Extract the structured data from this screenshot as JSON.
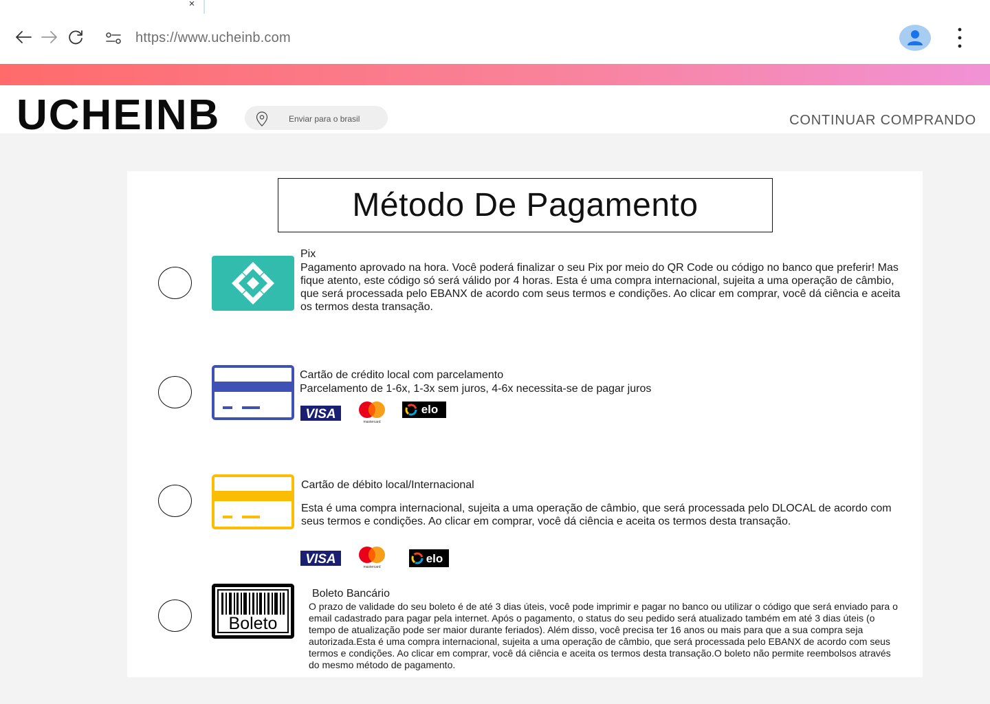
{
  "browser": {
    "tab_close_glyph": "×",
    "url": "https://www.ucheinb.com",
    "icons": [
      "close-icon",
      "arrow-left-icon",
      "arrow-right-icon",
      "reload-icon",
      "site-settings-icon",
      "profile-icon",
      "more-vertical-icon"
    ]
  },
  "brand_bar": {
    "colors": [
      "#ff6b6b",
      "#f9829a",
      "#f192d6"
    ]
  },
  "header": {
    "logo": "UCHEINB",
    "ship_to": "Enviar para o brasil",
    "ship_icon": "location-pin-icon",
    "continue": "CONTINUAR COMPRANDO"
  },
  "payment": {
    "title": "Método De Pagamento",
    "methods": [
      {
        "id": "pix",
        "title": "Pix",
        "description": "Pagamento aprovado na hora. Você poderá finalizar o seu Pix por meio do QR Code ou código no banco que preferir! Mas fique atento, este código só será válido por 4 horas. Esta é uma compra internacional, sujeita a uma operação de câmbio, que será processada pelo EBANX de acordo com seus termos e condições. Ao clicar em comprar, você dá ciência e aceita os termos desta transação.",
        "logo_color": "#32bcad"
      },
      {
        "id": "credit",
        "title": "Cartão de crédito local com parcelamento",
        "description": "Parcelamento de 1-6x, 1-3x sem juros, 4-6x necessita-se de pagar juros",
        "logo_color": "#3f51b5",
        "brands": [
          "VISA",
          "mastercard",
          "elo"
        ]
      },
      {
        "id": "debit",
        "title": "Cartão de débito local/Internacional",
        "description": "Esta é uma compra internacional, sujeita a uma operação de câmbio, que será processada pelo DLOCAL de acordo com seus termos e condições. Ao clicar em comprar, você dá ciência e aceita os termos desta transação.",
        "logo_color": "#fbbc04",
        "brands": [
          "VISA",
          "mastercard",
          "elo"
        ]
      },
      {
        "id": "boleto",
        "title": "Boleto Bancário",
        "logo_text": "Boleto",
        "description": "O prazo de validade do seu boleto é de até 3 dias úteis, você pode imprimir e pagar no banco ou utilizar o código que será enviado para o email cadastrado para pagar pela internet. Após o pagamento, o status do seu pedido será atualizado também em até 3 dias úteis (o tempo de atualização pode ser maior durante feriados). Além disso, você precisa ter 16 anos ou mais para que a sua compra seja autorizada.Esta é uma compra internacional, sujeita a uma operação de câmbio, que será processada pelo EBANX de acordo com seus termos e condições. Ao clicar em comprar, você dá ciência e aceita os termos desta transação.O boleto não permite reembolsos através do mesmo método de pagamento."
      }
    ]
  }
}
